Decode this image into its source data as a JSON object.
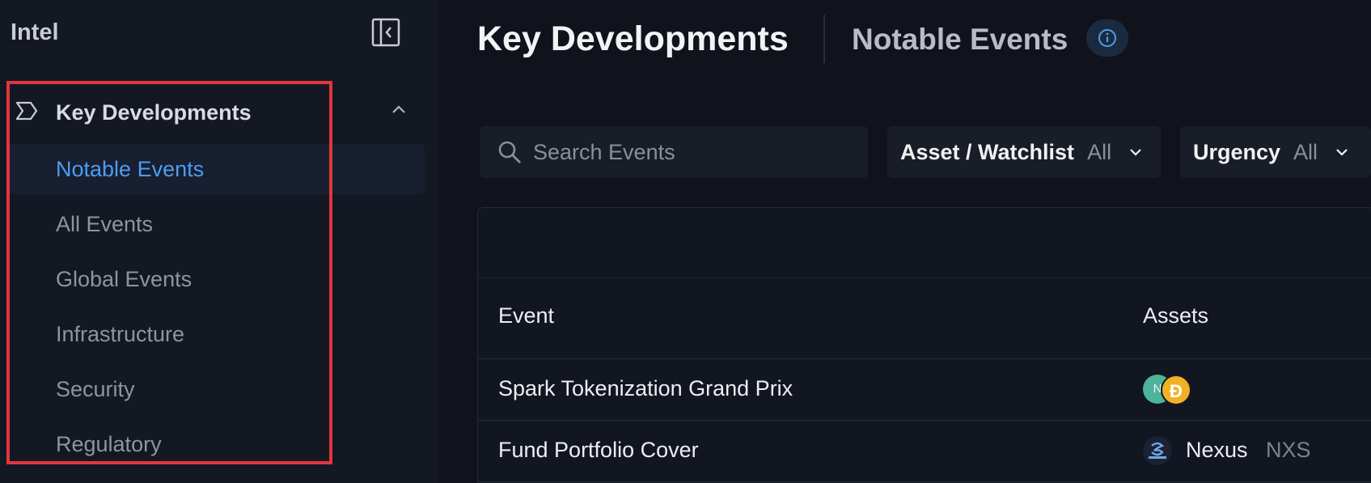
{
  "sidebar": {
    "title": "Intel",
    "section": {
      "label": "Key Developments"
    },
    "items": [
      {
        "label": "Notable Events",
        "active": true
      },
      {
        "label": "All Events",
        "active": false
      },
      {
        "label": "Global Events",
        "active": false
      },
      {
        "label": "Infrastructure",
        "active": false
      },
      {
        "label": "Security",
        "active": false
      },
      {
        "label": "Regulatory",
        "active": false
      }
    ]
  },
  "header": {
    "title": "Key Developments",
    "tab": "Notable Events",
    "info_icon": "info-icon"
  },
  "filters": {
    "search_placeholder": "Search Events",
    "asset": {
      "label": "Asset / Watchlist",
      "value": "All"
    },
    "urgency": {
      "label": "Urgency",
      "value": "All"
    }
  },
  "table": {
    "columns": [
      "Event",
      "Assets"
    ],
    "rows": [
      {
        "event": "Spark Tokenization Grand Prix",
        "assets": []
      },
      {
        "event": "Fund Portfolio Cover",
        "asset_name": "Nexus",
        "asset_ticker": "NXS"
      }
    ]
  },
  "colors": {
    "accent": "#4e9cf0",
    "highlight": "#e2363d",
    "background": "#10131b",
    "sidebar": "#141823"
  }
}
